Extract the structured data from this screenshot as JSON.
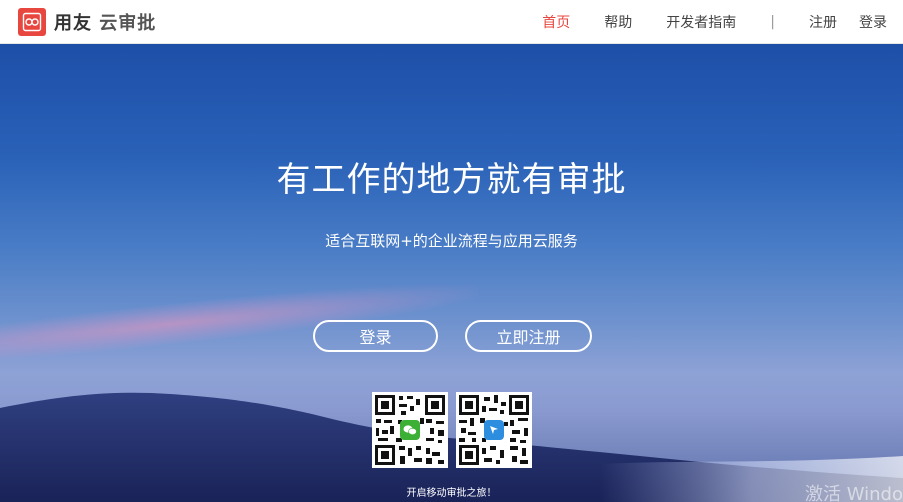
{
  "brand": {
    "name": "用友",
    "product": "云审批",
    "icon": "cloud-link-logo-icon",
    "color": "#e8473f"
  },
  "nav": {
    "items": [
      {
        "label": "首页",
        "active": true
      },
      {
        "label": "帮助",
        "active": false
      },
      {
        "label": "开发者指南",
        "active": false
      }
    ],
    "separator": "|",
    "register": "注册",
    "login": "登录"
  },
  "hero": {
    "title": "有工作的地方就有审批",
    "subtitle": "适合互联网+的企业流程与应用云服务",
    "login_button": "登录",
    "register_button": "立即注册",
    "qr_codes": [
      {
        "icon": "wechat-icon"
      },
      {
        "icon": "app-icon"
      }
    ],
    "caption": "开启移动审批之旅！"
  },
  "watermark": "激活 Windo"
}
